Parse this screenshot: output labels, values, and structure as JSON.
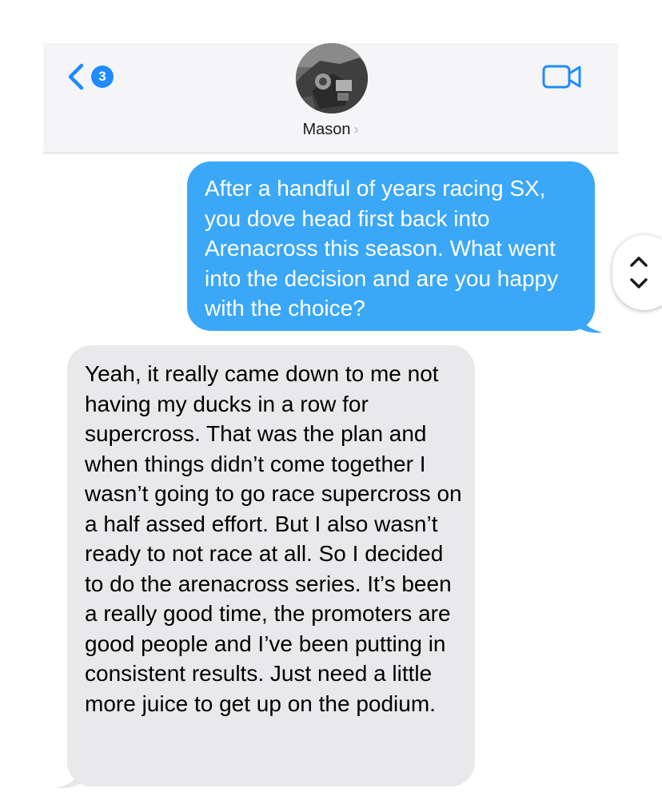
{
  "header": {
    "unread_count": "3",
    "contact_name": "Mason",
    "contact_chevron": "›",
    "icons": {
      "back": "chevron-left",
      "video": "video-camera",
      "avatar": "contact-photo"
    }
  },
  "messages": [
    {
      "direction": "sent",
      "text": "After a handful of years racing SX, you dove head first back into Arenacross this season. What went into the decision and are you happy with the choice?"
    },
    {
      "direction": "received",
      "text": "Yeah, it really came down to me not having my ducks in a row for supercross. That was the plan and when things didn’t come together I wasn’t going to go race supercross on a half assed effort. But I also wasn’t ready to not race at all. So I decided to do the arenacross series. It’s been a really good time, the promoters are good people and I’ve been putting in consistent results. Just need a little more juice to get up on the podium."
    }
  ],
  "colors": {
    "accent": "#1f8bff",
    "sent_bubble": "#3ba7f7",
    "received_bubble": "#e9e9eb",
    "header_bg": "#f5f5f7"
  },
  "scroll_handle": {
    "icon": "chevron-up-down"
  }
}
